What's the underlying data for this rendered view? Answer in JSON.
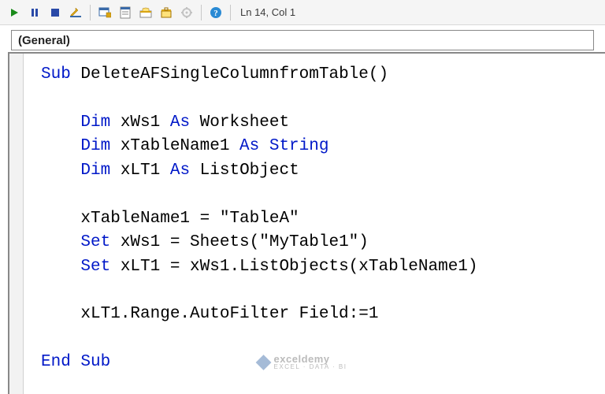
{
  "status": {
    "position": "Ln 14, Col 1"
  },
  "dropdown": {
    "selected": "(General)"
  },
  "code": {
    "t01a": "Sub",
    "t01b": " DeleteAFSingleColumnfromTable()",
    "t02a": "    Dim",
    "t02b": " xWs1 ",
    "t02c": "As",
    "t02d": " Worksheet",
    "t03a": "    Dim",
    "t03b": " xTableName1 ",
    "t03c": "As String",
    "t04a": "    Dim",
    "t04b": " xLT1 ",
    "t04c": "As",
    "t04d": " ListObject",
    "t05": "    xTableName1 = \"TableA\"",
    "t06a": "    Set",
    "t06b": " xWs1 = Sheets(\"MyTable1\")",
    "t07a": "    Set",
    "t07b": " xLT1 = xWs1.ListObjects(xTableName1)",
    "t08": "    xLT1.Range.AutoFilter Field:=1",
    "t09": "End Sub"
  },
  "watermark": {
    "brand": "exceldemy",
    "tag": "EXCEL · DATA · BI"
  }
}
